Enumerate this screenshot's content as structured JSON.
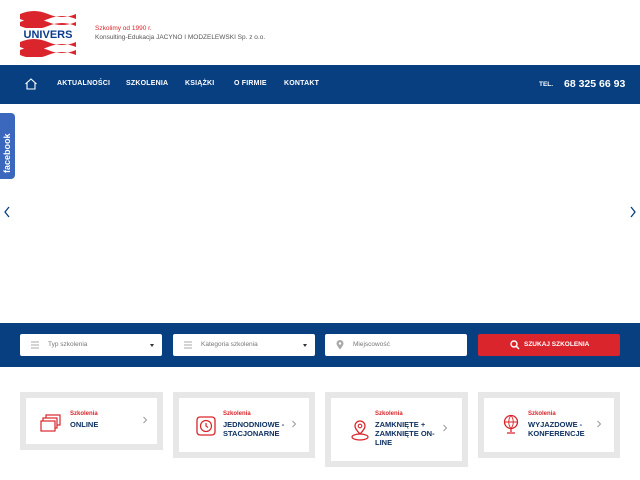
{
  "header": {
    "logo_text": "UNIVERS",
    "tagline_line1": "Szkolimy od 1990 r.",
    "tagline_line2": "Konsulting-Edukacja JACYNO I MODZELEWSKI Sp. z o.o."
  },
  "nav": {
    "home_icon": "home-icon",
    "items": [
      {
        "label": "AKTUALNOŚCI"
      },
      {
        "label": "SZKOLENIA"
      },
      {
        "label": "KSIĄŻKI"
      },
      {
        "label": "O FIRMIE"
      },
      {
        "label": "KONTAKT"
      }
    ],
    "tel_label": "TEL.",
    "tel_number": "68 325 66 93"
  },
  "facebook": {
    "label": "facebook"
  },
  "search": {
    "type_placeholder": "Typ szkolenia",
    "category_placeholder": "Kategoria szkolenia",
    "city_placeholder": "Miejscowość",
    "button_label": "SZUKAJ SZKOLENIA"
  },
  "cards": [
    {
      "label": "Szkolenia",
      "title": "ONLINE",
      "icon": "screens-icon"
    },
    {
      "label": "Szkolenia",
      "title": "JEDNODNIOWE - STACJONARNE",
      "icon": "clock-icon"
    },
    {
      "label": "Szkolenia",
      "title": "ZAMKNIĘTE + ZAMKNIĘTE ON-LINE",
      "icon": "location-pin-icon"
    },
    {
      "label": "Szkolenia",
      "title": "WYJAZDOWE - KONFERENCJE",
      "icon": "globe-icon"
    }
  ],
  "colors": {
    "navy": "#073f80",
    "red": "#d9252b",
    "facebook": "#3b67bd"
  }
}
